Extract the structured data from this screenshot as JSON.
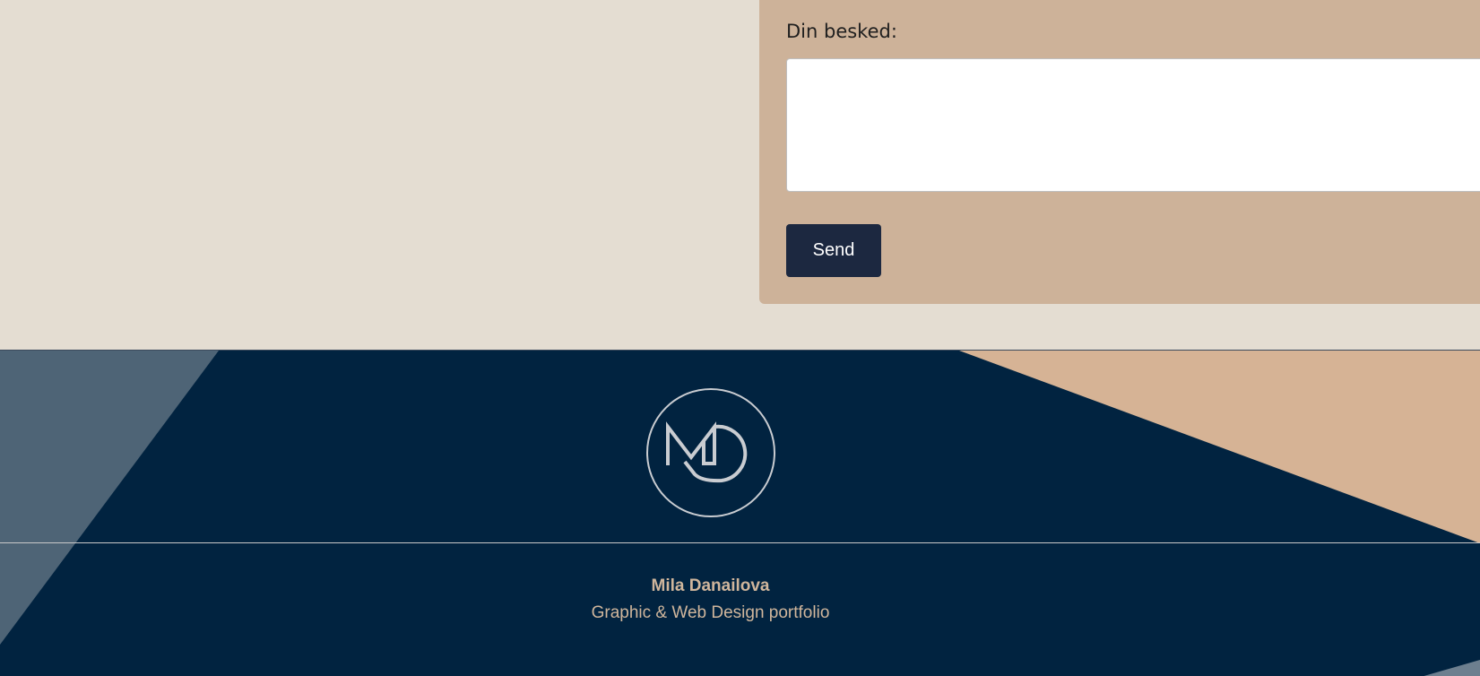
{
  "contact_form": {
    "message_label": "Din besked:",
    "message_value": "",
    "send_label": "Send"
  },
  "footer": {
    "name": "Mila Danailova",
    "tagline": "Graphic & Web Design portfolio"
  },
  "colors": {
    "page_background": "#e4ddd2",
    "form_card": "#cdb299",
    "button": "#1c2840",
    "footer_navy": "#012340",
    "footer_slate": "#4e6476",
    "footer_sand": "#d6b395",
    "footer_text": "#d0b69c"
  },
  "icons": {
    "logo": "md-monogram-logo-icon",
    "resize": "textarea-resize-grip-icon"
  }
}
